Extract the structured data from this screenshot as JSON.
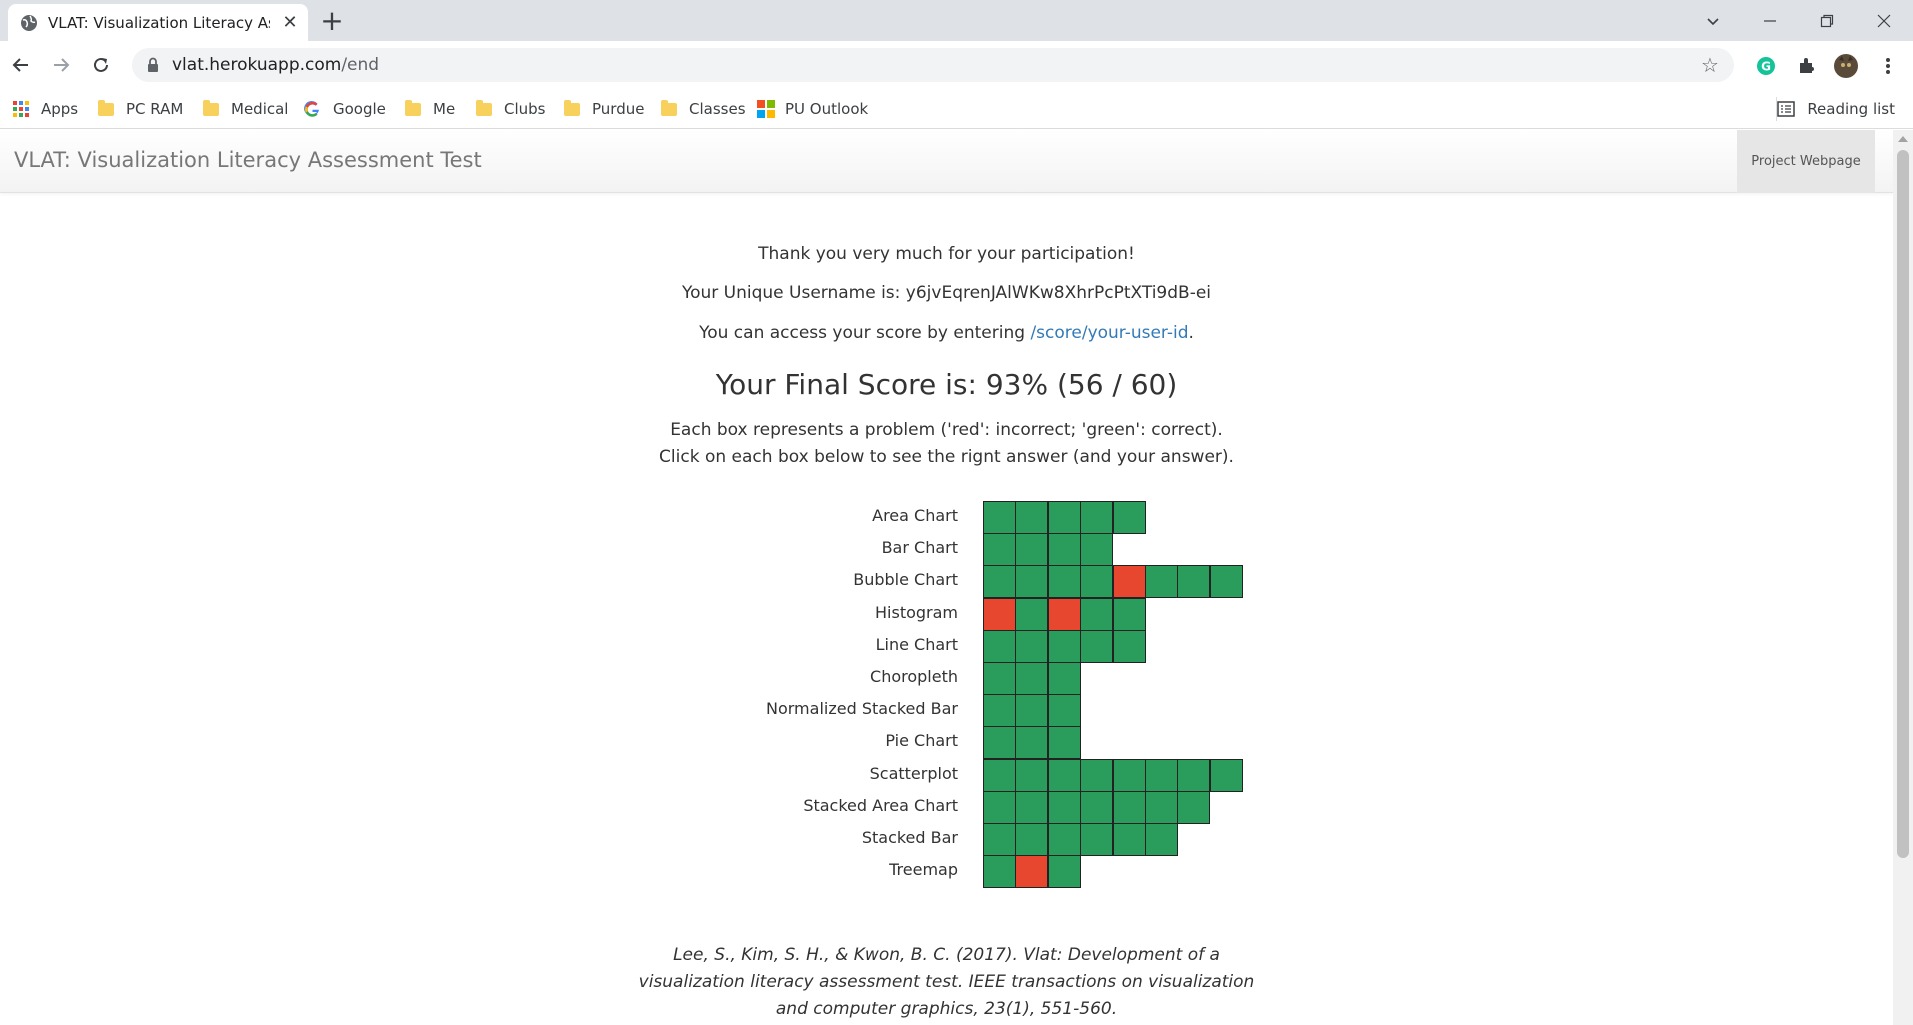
{
  "browser": {
    "tab_title": "VLAT: Visualization Literacy Assessment Test",
    "url_host": "vlat.herokuapp.com",
    "url_path": "/end",
    "bookmarks": [
      "Apps",
      "PC RAM",
      "Medical",
      "Google",
      "Me",
      "Clubs",
      "Purdue",
      "Classes",
      "PU Outlook"
    ],
    "reading_list": "Reading list"
  },
  "page": {
    "brand": "VLAT: Visualization Literacy Assessment Test",
    "project_link": "Project Webpage",
    "thanks": "Thank you very much for your participation!",
    "username": "Your Unique Username is: y6jvEqrenJAlWKw8XhrPcPtXTi9dB-ei",
    "access_prefix": "You can access your score by entering ",
    "access_link": "/score/your-user-id",
    "access_suffix": ".",
    "final_score": "Your Final Score is: 93% (56 / 60)",
    "legend_line1": "Each box represents a problem ('red': incorrect; 'green': correct).",
    "legend_line2": "Click on each box below to see the rignt answer (and your answer).",
    "citation": [
      "Lee, S., Kim, S. H., & Kwon, B. C. (2017). Vlat: Development of a",
      "visualization literacy assessment test. IEEE transactions on visualization",
      "and computer graphics, 23(1), 551-560."
    ]
  },
  "colors": {
    "correct": "#2a9d5c",
    "incorrect": "#e8472f"
  },
  "results": [
    {
      "label": "Area Chart",
      "boxes": [
        "correct",
        "correct",
        "correct",
        "correct",
        "correct"
      ]
    },
    {
      "label": "Bar Chart",
      "boxes": [
        "correct",
        "correct",
        "correct",
        "correct"
      ]
    },
    {
      "label": "Bubble Chart",
      "boxes": [
        "correct",
        "correct",
        "correct",
        "correct",
        "incorrect",
        "correct",
        "correct",
        "correct"
      ]
    },
    {
      "label": "Histogram",
      "boxes": [
        "incorrect",
        "correct",
        "incorrect",
        "correct",
        "correct"
      ]
    },
    {
      "label": "Line Chart",
      "boxes": [
        "correct",
        "correct",
        "correct",
        "correct",
        "correct"
      ]
    },
    {
      "label": "Choropleth",
      "boxes": [
        "correct",
        "correct",
        "correct"
      ]
    },
    {
      "label": "Normalized Stacked Bar",
      "boxes": [
        "correct",
        "correct",
        "correct"
      ]
    },
    {
      "label": "Pie Chart",
      "boxes": [
        "correct",
        "correct",
        "correct"
      ]
    },
    {
      "label": "Scatterplot",
      "boxes": [
        "correct",
        "correct",
        "correct",
        "correct",
        "correct",
        "correct",
        "correct",
        "correct"
      ]
    },
    {
      "label": "Stacked Area Chart",
      "boxes": [
        "correct",
        "correct",
        "correct",
        "correct",
        "correct",
        "correct",
        "correct"
      ]
    },
    {
      "label": "Stacked Bar",
      "boxes": [
        "correct",
        "correct",
        "correct",
        "correct",
        "correct",
        "correct"
      ]
    },
    {
      "label": "Treemap",
      "boxes": [
        "correct",
        "incorrect",
        "correct"
      ]
    }
  ]
}
